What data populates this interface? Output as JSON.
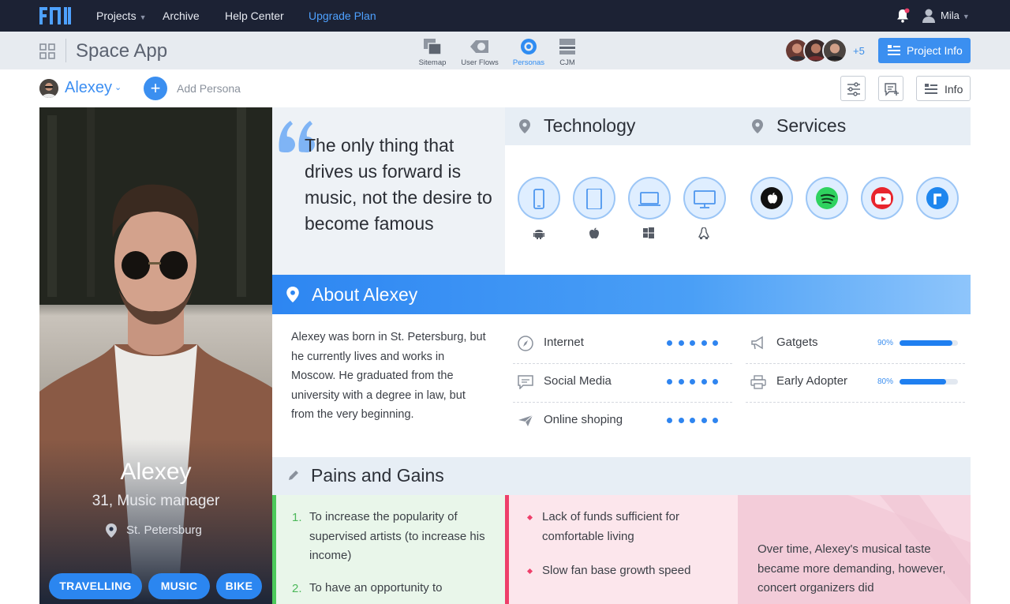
{
  "nav": {
    "projects": "Projects",
    "archive": "Archive",
    "help": "Help Center",
    "upgrade": "Upgrade Plan",
    "user": "Mila"
  },
  "subheader": {
    "title": "Space App",
    "tools": [
      {
        "label": "Sitemap",
        "icon": "sitemap-icon"
      },
      {
        "label": "User Flows",
        "icon": "user-flows-icon"
      },
      {
        "label": "Personas",
        "icon": "personas-icon",
        "active": true
      },
      {
        "label": "CJM",
        "icon": "cjm-icon"
      }
    ],
    "extra_members": "+5",
    "project_info": "Project Info"
  },
  "persona_bar": {
    "name": "Alexey",
    "add_label": "Add Persona",
    "info_label": "Info"
  },
  "persona": {
    "name": "Alexey",
    "role": "31, Music manager",
    "location": "St. Petersburg",
    "tags": [
      "TRAVELLING",
      "MUSIC",
      "BIKE"
    ]
  },
  "quote": "The only thing that drives us forward is music, not the desire to become famous",
  "technology": {
    "title": "Technology",
    "devices": [
      "smartphone-icon",
      "tablet-icon",
      "laptop-icon",
      "desktop-icon"
    ],
    "os": [
      "android-icon",
      "apple-icon",
      "windows-icon",
      "linux-icon"
    ]
  },
  "services": {
    "title": "Services",
    "items": [
      "apple-music-icon",
      "spotify-icon",
      "youtube-icon",
      "rdio-icon"
    ]
  },
  "about": {
    "title": "About Alexey",
    "text": "Alexey was born in St. Petersburg, but he currently lives and works in Moscow. He graduated from the university with a degree in law, but from the very beginning.",
    "metrics": [
      {
        "label": "Internet",
        "icon": "compass-icon",
        "rating": 5
      },
      {
        "label": "Social Media",
        "icon": "chat-icon",
        "rating": 5
      },
      {
        "label": "Online shoping",
        "icon": "plane-icon",
        "rating": 5
      }
    ],
    "bars": [
      {
        "label": "Gatgets",
        "icon": "megaphone-icon",
        "percent_label": "90%",
        "value": 0.9
      },
      {
        "label": "Early Adopter",
        "icon": "printer-icon",
        "percent_label": "80%",
        "value": 0.8
      }
    ]
  },
  "pains_gains": {
    "title": "Pains and Gains",
    "gains": [
      {
        "num": "1.",
        "text": "To increase the popularity of supervised artists (to increase his income)"
      },
      {
        "num": "2.",
        "text": "To have an opportunity to"
      }
    ],
    "pains": [
      "Lack of funds sufficient for comfortable living",
      "Slow fan base growth speed"
    ],
    "story": "Over time, Alexey's musical taste became more demanding, however, concert organizers did"
  },
  "colors": {
    "accent": "#3b8ff0",
    "nav_bg": "#1c2234",
    "gain": "#4cc95a",
    "pain": "#ee3f6a"
  }
}
